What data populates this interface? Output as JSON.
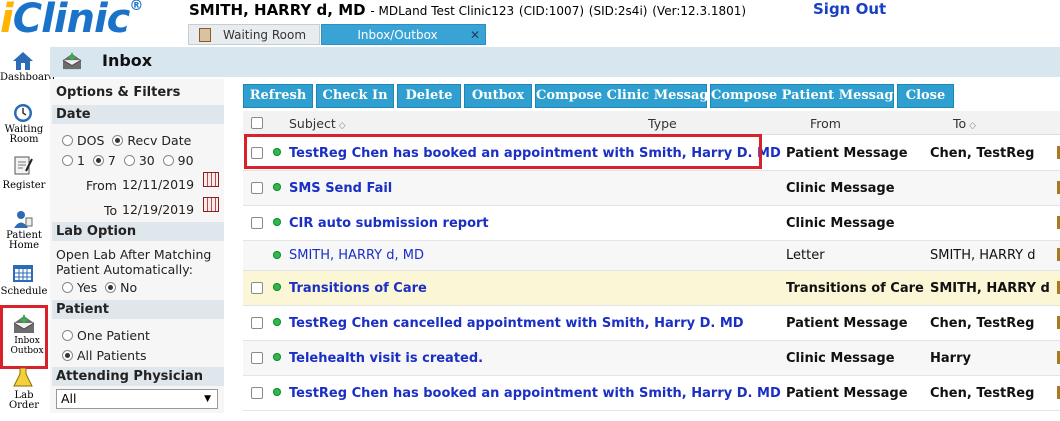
{
  "app": {
    "logo_i": "i",
    "logo_rest": "Clinic",
    "logo_mark": "®",
    "user_name": "SMITH, HARRY d, MD",
    "clinic_info": "- MDLand Test Clinic123",
    "cid": "(CID:1007)",
    "sid": "(SID:2s4i)",
    "ver": "(Ver:12.3.1801)",
    "sign_out": "Sign Out"
  },
  "tabs": [
    {
      "label": "Waiting Room"
    },
    {
      "label": "Inbox/Outbox",
      "close": "✕"
    }
  ],
  "rail": [
    {
      "label": "Dashboard"
    },
    {
      "label": "Waiting Room"
    },
    {
      "label": "Register"
    },
    {
      "label": "Patient Home"
    },
    {
      "label": "Schedule"
    },
    {
      "label": "Inbox Outbox"
    },
    {
      "label": "Lab Order"
    }
  ],
  "title": "Inbox",
  "filters": {
    "header": "Options & Filters",
    "date_header": "Date",
    "date_opt_dos": "DOS",
    "date_opt_recv": "Recv Date",
    "range_1": "1",
    "range_7": "7",
    "range_30": "30",
    "range_90": "90",
    "from_label": "From",
    "from_value": "12/11/2019",
    "to_label": "To",
    "to_value": "12/19/2019",
    "lab_header": "Lab Option",
    "lab_text_1": "Open Lab After Matching",
    "lab_text_2": "Patient Automatically:",
    "lab_yes": "Yes",
    "lab_no": "No",
    "patient_header": "Patient",
    "patient_one": "One Patient",
    "patient_all": "All Patients",
    "physician_header": "Attending Physician",
    "physician_value": "All"
  },
  "toolbar": {
    "refresh": "Refresh",
    "check_in": "Check In",
    "delete": "Delete",
    "outbox": "Outbox",
    "compose_clinic": "Compose Clinic Message",
    "compose_patient": "Compose Patient Message",
    "close": "Close"
  },
  "table": {
    "col_subject": "Subject",
    "col_type": "Type",
    "col_from": "From",
    "col_to": "To",
    "sort_glyph": "◇",
    "rows": [
      {
        "subject": "TestReg Chen has booked an appointment with Smith, Harry D. MD",
        "from": "Patient Message",
        "to": "Chen, TestReg"
      },
      {
        "subject": "SMS Send Fail",
        "from": "Clinic Message",
        "to": ""
      },
      {
        "subject": "CIR auto submission report",
        "from": "Clinic Message",
        "to": ""
      },
      {
        "subject": "SMITH, HARRY d, MD",
        "from": "Letter",
        "to": "SMITH, HARRY d"
      },
      {
        "subject": "Transitions of Care",
        "from": "Transitions of Care",
        "to": "SMITH, HARRY d"
      },
      {
        "subject": "TestReg Chen cancelled appointment with Smith, Harry D. MD",
        "from": "Patient Message",
        "to": "Chen, TestReg"
      },
      {
        "subject": "Telehealth visit is created.",
        "from": "Clinic Message",
        "to": "Harry"
      },
      {
        "subject": "TestReg Chen has booked an appointment with Smith, Harry D. MD",
        "from": "Patient Message",
        "to": "Chen, TestReg"
      }
    ]
  },
  "colors": {
    "accent": "#2f9fd0",
    "link": "#1a2fc4",
    "highlight": "#d8212a",
    "status_dot": "#2db84a"
  }
}
